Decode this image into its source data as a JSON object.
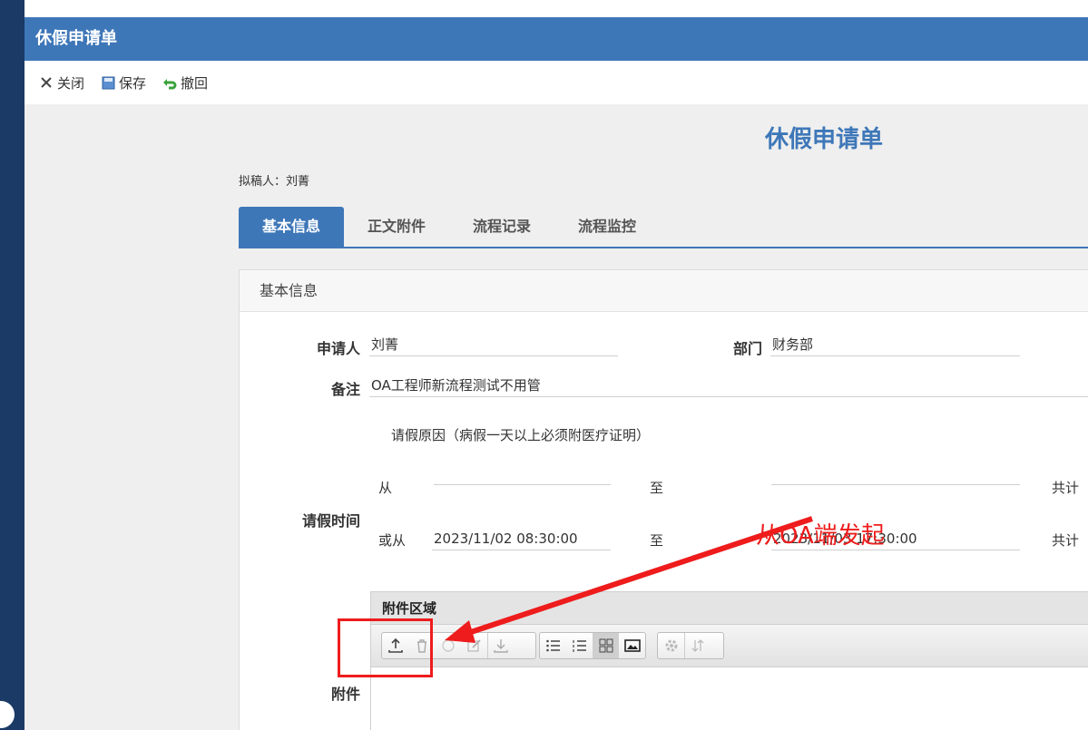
{
  "window": {
    "title": "休假申请单"
  },
  "toolbar": {
    "close_label": "关闭",
    "save_label": "保存",
    "undo_label": "撤回"
  },
  "form": {
    "title": "休假申请单",
    "drafter": "拟稿人：刘菁",
    "tabs": [
      "基本信息",
      "正文附件",
      "流程记录",
      "流程监控"
    ],
    "panel_title": "基本信息",
    "applicant_label": "申请人",
    "applicant": "刘菁",
    "dept_label": "部门",
    "dept": "财务部",
    "remark_label": "备注",
    "remark": "OA工程师新流程测试不用管",
    "reason_label": "请假原因（病假一天以上必须附医疗证明）",
    "time_label": "请假时间",
    "from_label": "从",
    "to_label": "至",
    "total_label": "共计",
    "or_from_label": "或从",
    "or_from_value": "2023/11/02 08:30:00",
    "or_to_value": "2023/11/03 17:30:00",
    "attachment_label": "附件",
    "attachment_area_title": "附件区域"
  },
  "annotation": {
    "text": "从OA端发起",
    "color": "#ee1c1c"
  },
  "colors": {
    "brand": "#3e77b8",
    "sidebar": "#1b3a66"
  }
}
